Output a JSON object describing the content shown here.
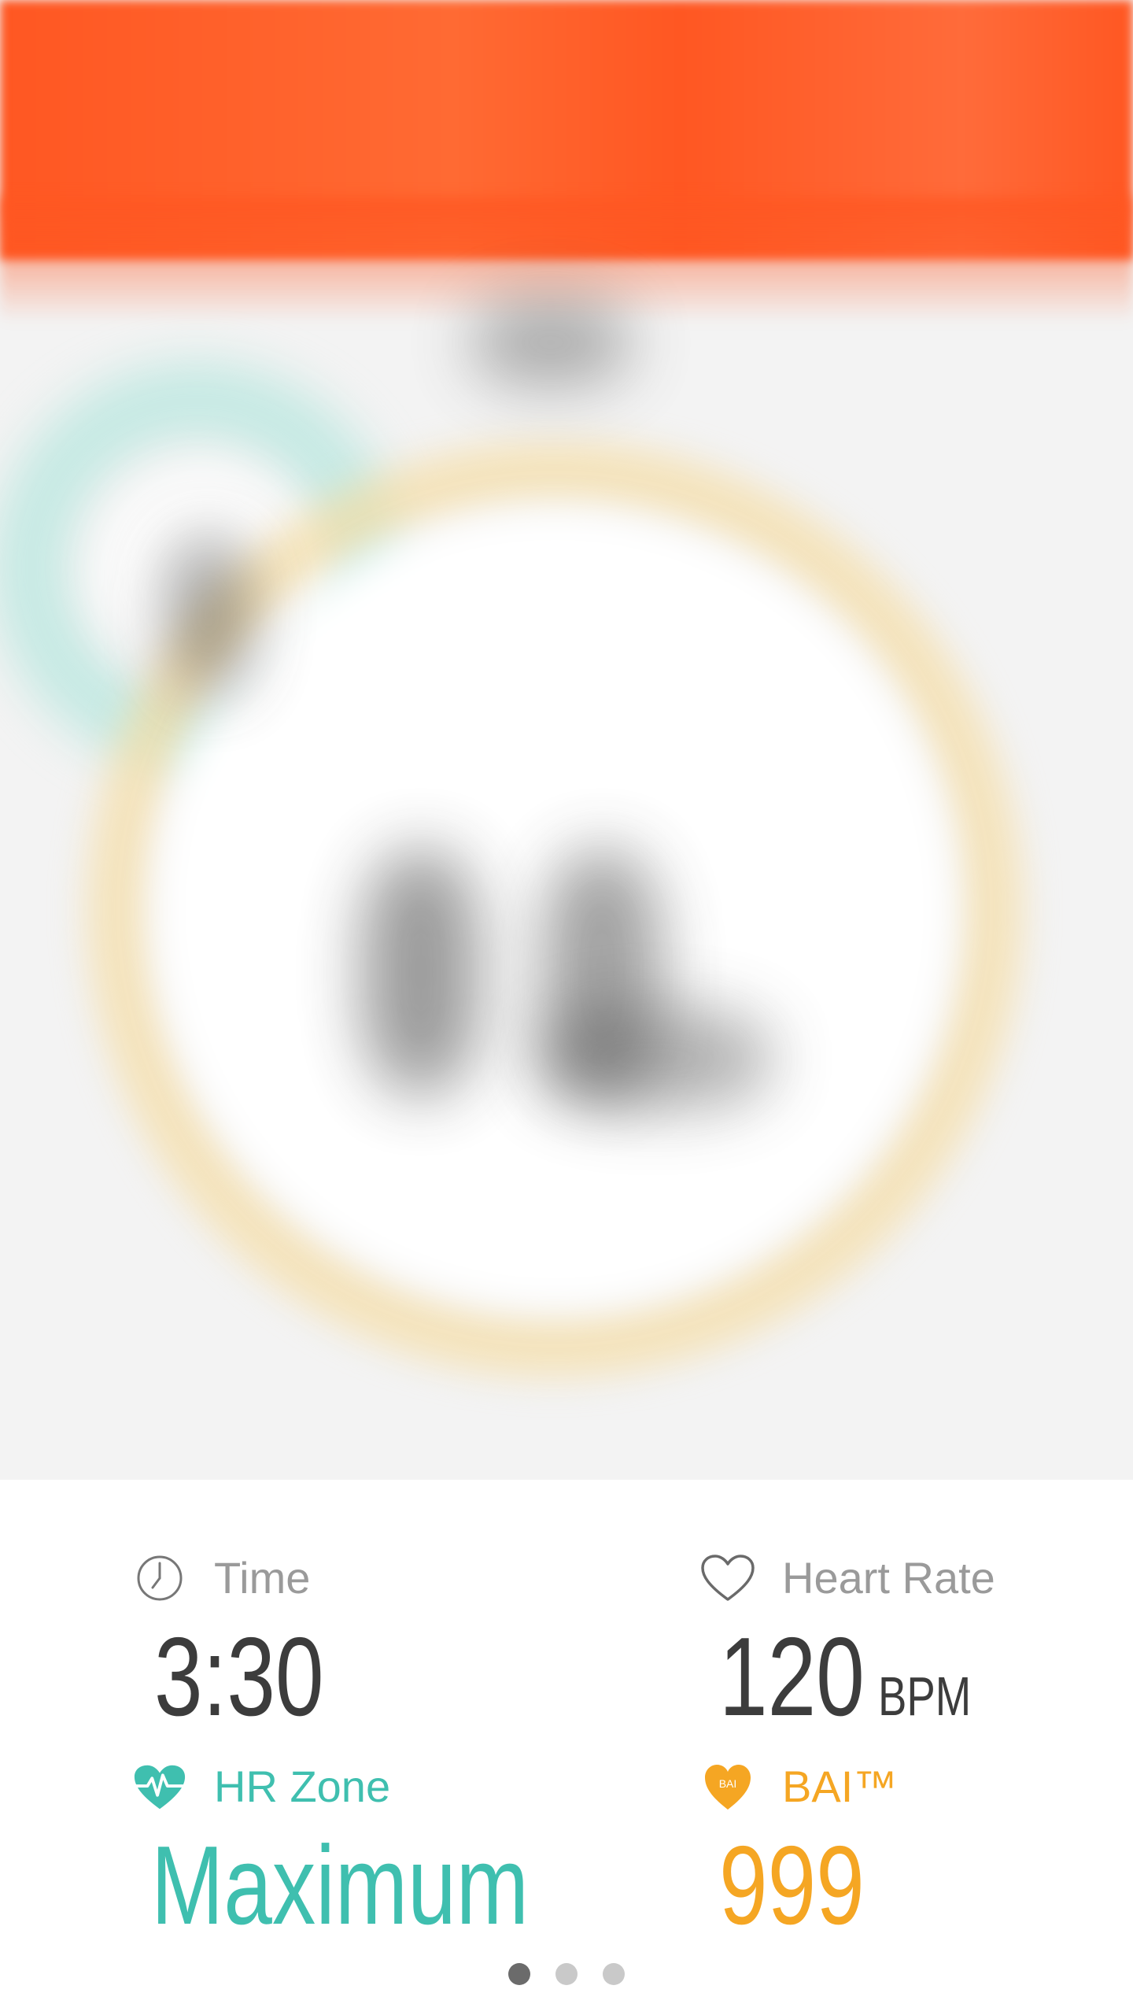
{
  "colors": {
    "header": "#ff5722",
    "teal": "#3fbfaf",
    "orange": "#f5a623",
    "dark_text": "#3c3c3c",
    "gray_text": "#9a9a9a"
  },
  "stats": {
    "time": {
      "label": "Time",
      "value": "3:30",
      "icon": "clock-icon"
    },
    "heart_rate": {
      "label": "Heart Rate",
      "value": "120",
      "unit": "BPM",
      "icon": "heart-outline-icon"
    },
    "hr_zone": {
      "label": "HR Zone",
      "value": "Maximum",
      "icon": "heart-pulse-icon"
    },
    "bai": {
      "label": "BAI™",
      "value": "999",
      "icon": "bai-heart-icon",
      "badge_text": "BAI"
    }
  },
  "pager": {
    "count": 3,
    "active_index": 0
  }
}
